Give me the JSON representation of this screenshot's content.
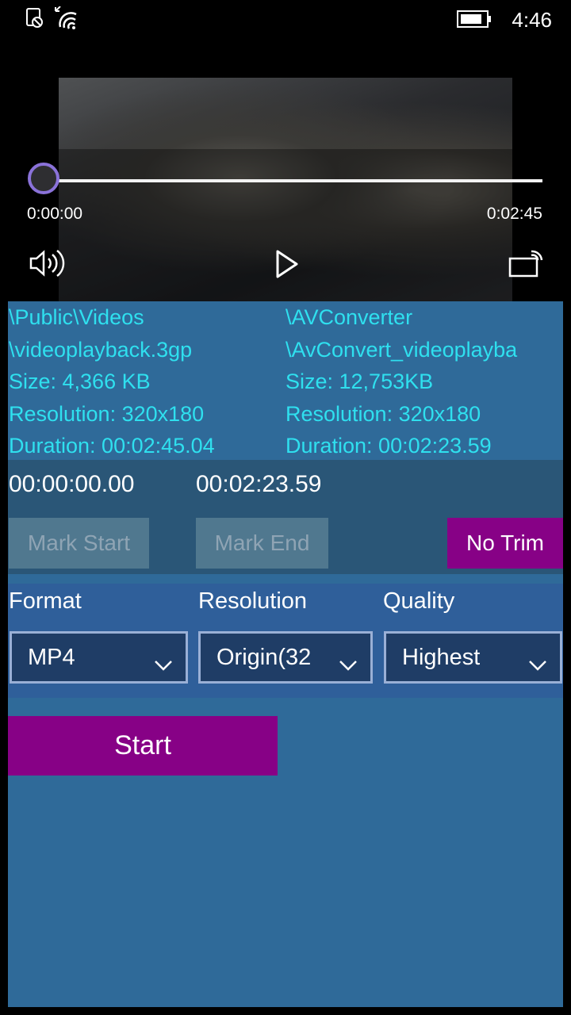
{
  "status_bar": {
    "time": "4:46",
    "icons": [
      "notification-off-icon",
      "wifi-icon",
      "battery-icon"
    ]
  },
  "player": {
    "current_time": "0:00:00",
    "total_time": "0:02:45",
    "progress": 0,
    "controls": [
      "volume-icon",
      "play-icon",
      "cast-icon"
    ]
  },
  "source": {
    "folder": "\\Public\\Videos",
    "file": "\\videoplayback.3gp",
    "size": "Size: 4,366 KB",
    "resolution": "Resolution: 320x180",
    "duration": "Duration: 00:02:45.04"
  },
  "output": {
    "folder": "\\AVConverter",
    "file": "\\AvConvert_videoplayba",
    "size": "Size: 12,753KB",
    "resolution": "Resolution: 320x180",
    "duration": "Duration: 00:02:23.59"
  },
  "trim": {
    "start_time": "00:00:00.00",
    "end_time": "00:02:23.59",
    "mark_start_label": "Mark Start",
    "mark_end_label": "Mark End",
    "no_trim_label": "No Trim"
  },
  "options": {
    "format_label": "Format",
    "format_value": "MP4",
    "resolution_label": "Resolution",
    "resolution_value": "Origin(32",
    "quality_label": "Quality",
    "quality_value": "Highest"
  },
  "start_label": "Start",
  "colors": {
    "accent_purple": "#870186",
    "panel_blue": "#2f6a99",
    "info_cyan": "#2fe0ef",
    "seek_thumb": "#8a72d9"
  }
}
